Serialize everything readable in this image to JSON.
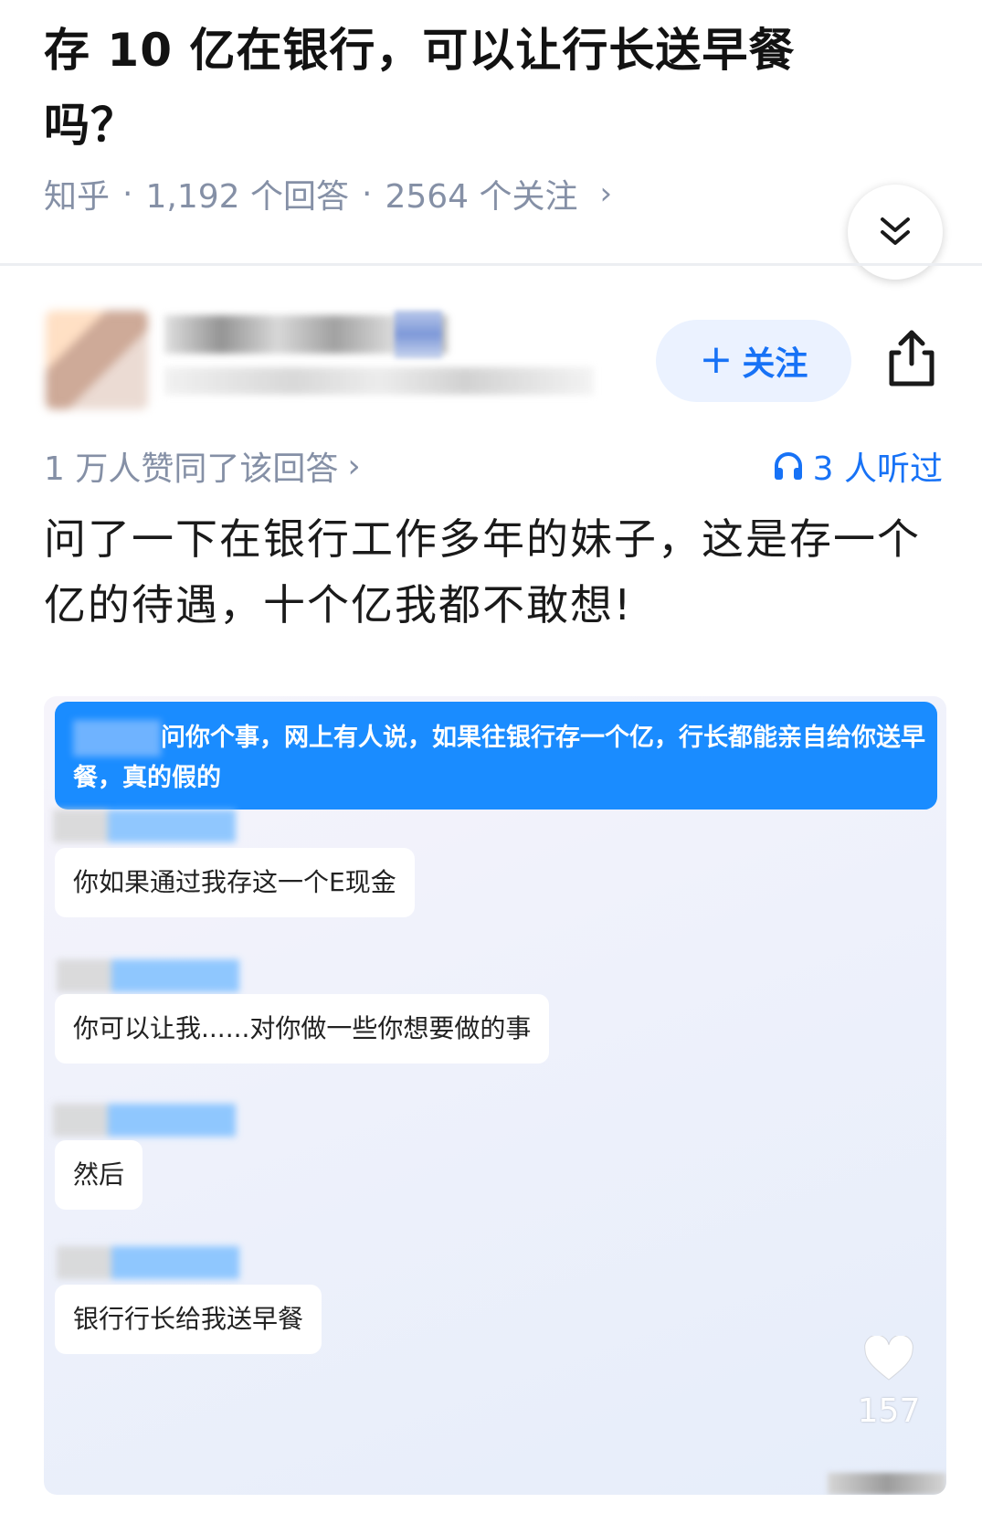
{
  "question": {
    "title": "存 10 亿在银行，可以让行长送早餐吗？",
    "source": "知乎",
    "answers": "1,192 个回答",
    "followers": "2564 个关注",
    "separator": "·",
    "chevron": "›"
  },
  "author": {
    "follow_label": "关注"
  },
  "answer": {
    "votes": "1 万人赞同了该回答",
    "listeners": "3 人听过",
    "text": "问了一下在银行工作多年的妹子，这是存一个亿的待遇，十个亿我都不敢想!"
  },
  "chat": {
    "question": "问你个事，网上有人说，如果往银行存一个亿，行长都能亲自给你送早餐，真的假的",
    "replies": [
      "你如果通过我存这一个E现金",
      "你可以让我......对你做一些你想要做的事",
      "然后",
      "银行行长给我送早餐"
    ]
  },
  "like": {
    "count": "157"
  },
  "icons": {
    "collapse": "double-chevron-down-icon",
    "share": "share-icon",
    "listen": "headphones-icon",
    "like": "heart-icon"
  },
  "colors": {
    "accent": "#1772f6",
    "meta_gray": "#8590a6",
    "chat_blue": "#1a8cff"
  }
}
